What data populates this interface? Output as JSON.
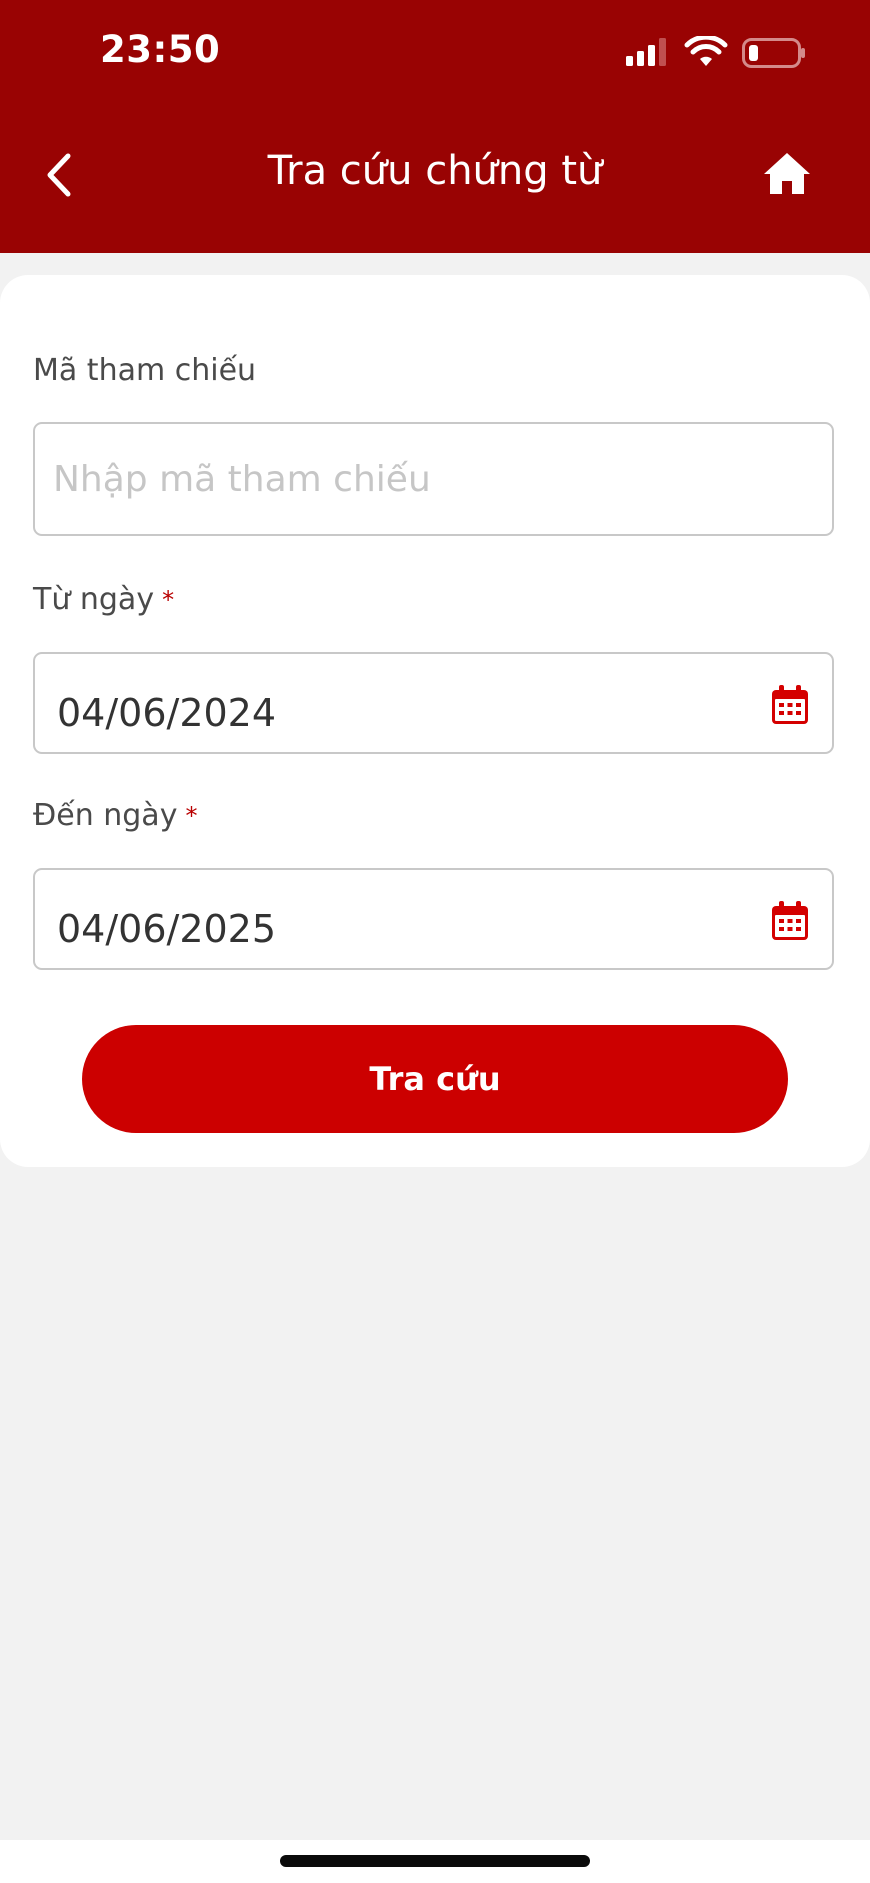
{
  "status_bar": {
    "time": "23:50"
  },
  "header": {
    "title": "Tra cứu chứng từ",
    "back_icon": "chevron-left-icon",
    "home_icon": "home-icon"
  },
  "form": {
    "reference": {
      "label": "Mã tham chiếu",
      "placeholder": "Nhập mã tham chiếu",
      "value": ""
    },
    "from_date": {
      "label": "Từ ngày",
      "required_mark": "*",
      "value": "04/06/2024",
      "icon": "calendar-icon"
    },
    "to_date": {
      "label": "Đến ngày",
      "required_mark": "*",
      "value": "04/06/2025",
      "icon": "calendar-icon"
    },
    "submit_label": "Tra cứu"
  },
  "colors": {
    "header_bg": "#990303",
    "primary_button": "#cc0000",
    "required": "#b90000",
    "page_bg": "#f2f2f2"
  }
}
